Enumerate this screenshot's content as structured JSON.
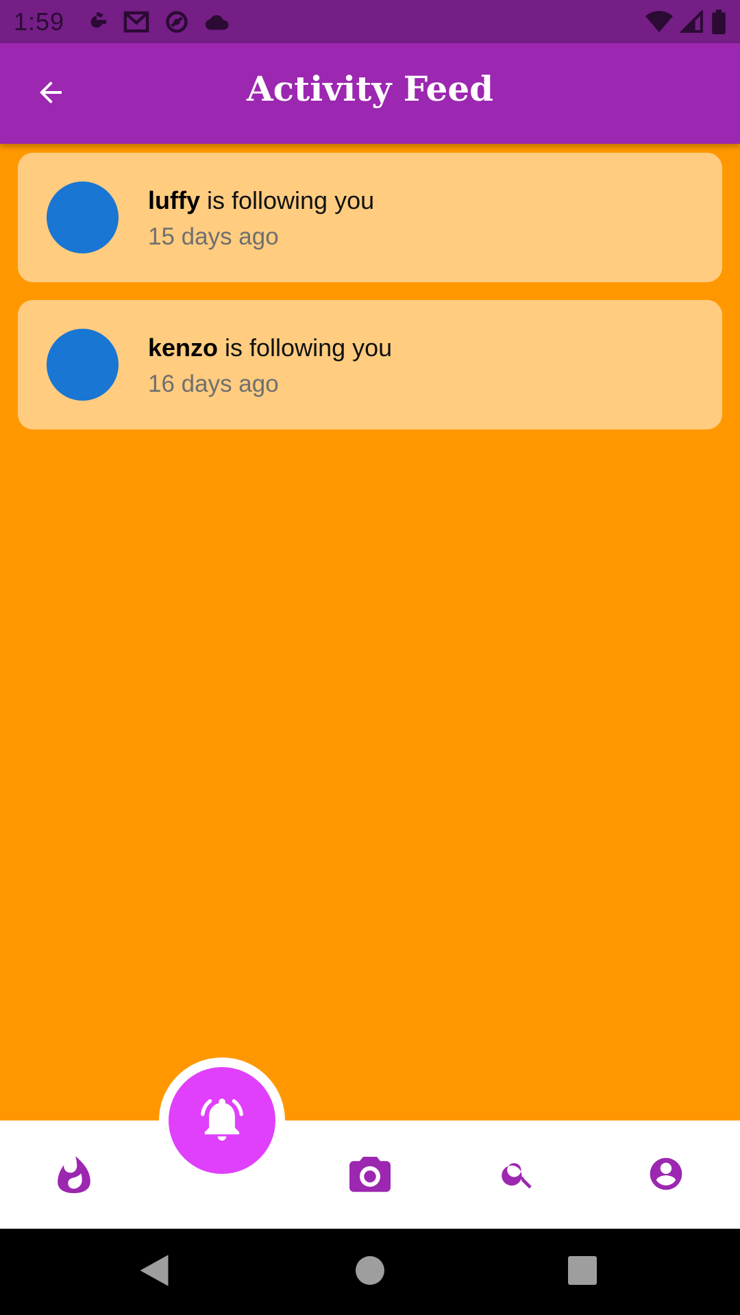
{
  "status_bar": {
    "time": "1:59",
    "icons_left": [
      "google-icon",
      "gmail-icon",
      "sync-icon",
      "cloud-icon"
    ],
    "icons_right": [
      "wifi-icon",
      "cell-signal-icon",
      "battery-icon"
    ]
  },
  "app_bar": {
    "title": "Activity Feed",
    "back_icon": "arrow-back-icon"
  },
  "feed": {
    "items": [
      {
        "username": "luffy",
        "action": " is following you",
        "time": "15 days ago"
      },
      {
        "username": "kenzo",
        "action": " is following you",
        "time": "16 days ago"
      }
    ]
  },
  "bottom_nav": {
    "items": [
      "flame-icon",
      "bell-ring-icon",
      "camera-icon",
      "search-icon",
      "account-circle-icon"
    ],
    "active": "bell-ring-icon"
  },
  "colors": {
    "status_bar": "#741e86",
    "app_bar": "#9c27b0",
    "background": "#ff9800",
    "card": "#ffcc80",
    "avatar": "#1976d2",
    "fab": "#e040fb",
    "nav_icon": "#9c27b0"
  }
}
